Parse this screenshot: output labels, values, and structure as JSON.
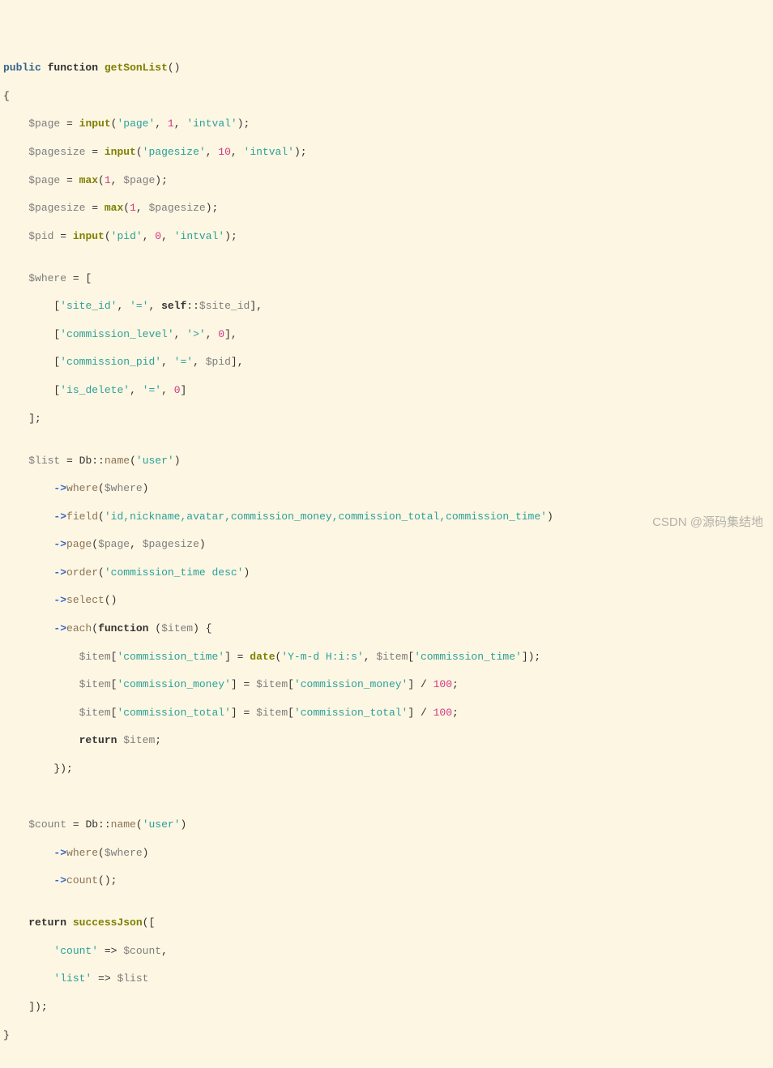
{
  "watermark": "CSDN @源码集结地",
  "code": {
    "l01_public": "public",
    "l01_function": "function",
    "l01_name": "getSonList",
    "l01_pa": "()",
    "l02_brace": "{",
    "l03_var": "$page",
    "l03_eq": " = ",
    "l03_fn": "input",
    "l03_p": "(",
    "l03_s1": "'page'",
    "l03_c1": ", ",
    "l03_n1": "1",
    "l03_c2": ", ",
    "l03_s2": "'intval'",
    "l03_end": ");",
    "l04_var": "$pagesize",
    "l04_eq": " = ",
    "l04_fn": "input",
    "l04_p": "(",
    "l04_s1": "'pagesize'",
    "l04_c1": ", ",
    "l04_n1": "10",
    "l04_c2": ", ",
    "l04_s2": "'intval'",
    "l04_end": ");",
    "l05_var": "$page",
    "l05_eq": " = ",
    "l05_fn": "max",
    "l05_p": "(",
    "l05_n1": "1",
    "l05_c": ", ",
    "l05_v2": "$page",
    "l05_end": ");",
    "l06_var": "$pagesize",
    "l06_eq": " = ",
    "l06_fn": "max",
    "l06_p": "(",
    "l06_n1": "1",
    "l06_c": ", ",
    "l06_v2": "$pagesize",
    "l06_end": ");",
    "l07_var": "$pid",
    "l07_eq": " = ",
    "l07_fn": "input",
    "l07_p": "(",
    "l07_s1": "'pid'",
    "l07_c1": ", ",
    "l07_n1": "0",
    "l07_c2": ", ",
    "l07_s2": "'intval'",
    "l07_end": ");",
    "l09_var": "$where",
    "l09_rest": " = [",
    "l10_b1": "[",
    "l10_s1": "'site_id'",
    "l10_c1": ", ",
    "l10_s2": "'='",
    "l10_c2": ", ",
    "l10_self": "self",
    "l10_sc": "::",
    "l10_siteid": "$site_id",
    "l10_end": "],",
    "l11_b1": "[",
    "l11_s1": "'commission_level'",
    "l11_c1": ", ",
    "l11_s2": "'>'",
    "l11_c2": ", ",
    "l11_n": "0",
    "l11_end": "],",
    "l12_b1": "[",
    "l12_s1": "'commission_pid'",
    "l12_c1": ", ",
    "l12_s2": "'='",
    "l12_c2": ", ",
    "l12_v": "$pid",
    "l12_end": "],",
    "l13_b1": "[",
    "l13_s1": "'is_delete'",
    "l13_c1": ", ",
    "l13_s2": "'='",
    "l13_c2": ", ",
    "l13_n": "0",
    "l13_end": "]",
    "l14_end": "];",
    "l16_var": "$list",
    "l16_eq": " = ",
    "l16_cls": "Db",
    "l16_sc": "::",
    "l16_m": "name",
    "l16_p": "(",
    "l16_s": "'user'",
    "l16_end": ")",
    "l17_arr": "->",
    "l17_m": "where",
    "l17_p": "(",
    "l17_v": "$where",
    "l17_end": ")",
    "l18_arr": "->",
    "l18_m": "field",
    "l18_p": "(",
    "l18_s": "'id,nickname,avatar,commission_money,commission_total,commission_time'",
    "l18_end": ")",
    "l19_arr": "->",
    "l19_m": "page",
    "l19_p": "(",
    "l19_v1": "$page",
    "l19_c": ", ",
    "l19_v2": "$pagesize",
    "l19_end": ")",
    "l20_arr": "->",
    "l20_m": "order",
    "l20_p": "(",
    "l20_s": "'commission_time desc'",
    "l20_end": ")",
    "l21_arr": "->",
    "l21_m": "select",
    "l21_end": "()",
    "l22_arr": "->",
    "l22_m": "each",
    "l22_p": "(",
    "l22_fn": "function",
    "l22_sp": " (",
    "l22_v": "$item",
    "l22_end": ") {",
    "l23_v": "$item",
    "l23_b1": "[",
    "l23_s1": "'commission_time'",
    "l23_b2": "] = ",
    "l23_fn": "date",
    "l23_p": "(",
    "l23_s2": "'Y-m-d H:i:s'",
    "l23_c": ", ",
    "l23_v2": "$item",
    "l23_b3": "[",
    "l23_s3": "'commission_time'",
    "l23_end": "]);",
    "l24_v": "$item",
    "l24_b1": "[",
    "l24_s1": "'commission_money'",
    "l24_b2": "] = ",
    "l24_v2": "$item",
    "l24_b3": "[",
    "l24_s2": "'commission_money'",
    "l24_b4": "] / ",
    "l24_n": "100",
    "l24_end": ";",
    "l25_v": "$item",
    "l25_b1": "[",
    "l25_s1": "'commission_total'",
    "l25_b2": "] = ",
    "l25_v2": "$item",
    "l25_b3": "[",
    "l25_s2": "'commission_total'",
    "l25_b4": "] / ",
    "l25_n": "100",
    "l25_end": ";",
    "l26_ret": "return",
    "l26_sp": " ",
    "l26_v": "$item",
    "l26_end": ";",
    "l27_end": "});",
    "l30_var": "$count",
    "l30_eq": " = ",
    "l30_cls": "Db",
    "l30_sc": "::",
    "l30_m": "name",
    "l30_p": "(",
    "l30_s": "'user'",
    "l30_end": ")",
    "l31_arr": "->",
    "l31_m": "where",
    "l31_p": "(",
    "l31_v": "$where",
    "l31_end": ")",
    "l32_arr": "->",
    "l32_m": "count",
    "l32_end": "();",
    "l34_ret": "return",
    "l34_sp": " ",
    "l34_fn": "successJson",
    "l34_p": "([",
    "l35_s": "'count'",
    "l35_fat": " => ",
    "l35_v": "$count",
    "l35_end": ",",
    "l36_s": "'list'",
    "l36_fat": " => ",
    "l36_v": "$list",
    "l37_end": "]);",
    "l38_brace": "}"
  }
}
